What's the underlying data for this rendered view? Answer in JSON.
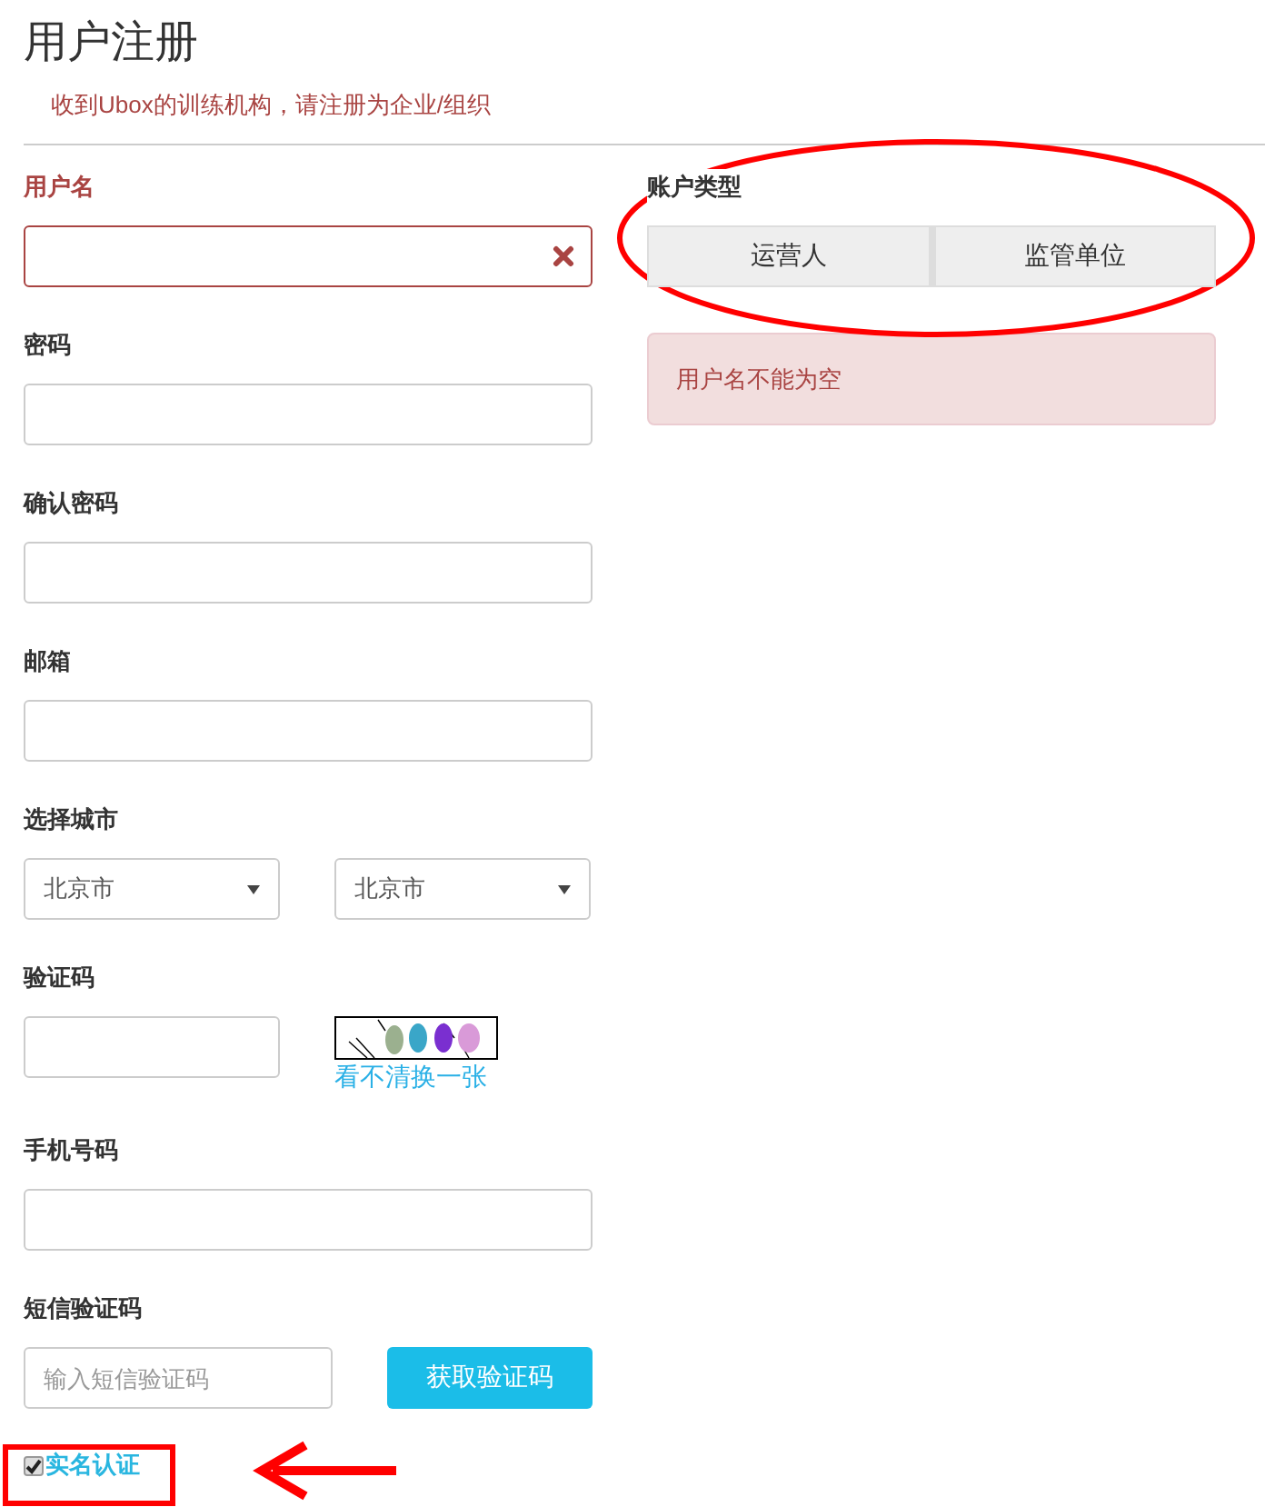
{
  "title": "用户注册",
  "subtitle": "收到Ubox的训练机构，请注册为企业/组织",
  "fields": [
    {
      "kind": "text",
      "label": "用户名",
      "error": true
    },
    {
      "kind": "text",
      "label": "密码",
      "error": false
    },
    {
      "kind": "text",
      "label": "确认密码",
      "error": false
    },
    {
      "kind": "text",
      "label": "邮箱",
      "error": false
    },
    {
      "kind": "select",
      "label": "选择城市",
      "error": false,
      "selects": [
        "北京市",
        "北京市"
      ]
    },
    {
      "kind": "captcha",
      "label": "验证码",
      "error": false,
      "link": "看不清换一张"
    },
    {
      "kind": "text",
      "label": "手机号码",
      "error": false
    },
    {
      "kind": "sms",
      "label": "短信验证码",
      "error": false,
      "placeholder": "输入短信验证码",
      "button": "获取验证码"
    }
  ],
  "realname": {
    "label": "实名认证",
    "checked": true
  },
  "account_type": {
    "label": "账户类型",
    "options": [
      {
        "label": "运营人",
        "selected": false
      },
      {
        "label": "监管单位",
        "selected": false
      }
    ]
  },
  "alert": "用户名不能为空",
  "annotations": [
    {
      "kind": "ellipse"
    },
    {
      "kind": "box"
    },
    {
      "kind": "arrow"
    }
  ]
}
